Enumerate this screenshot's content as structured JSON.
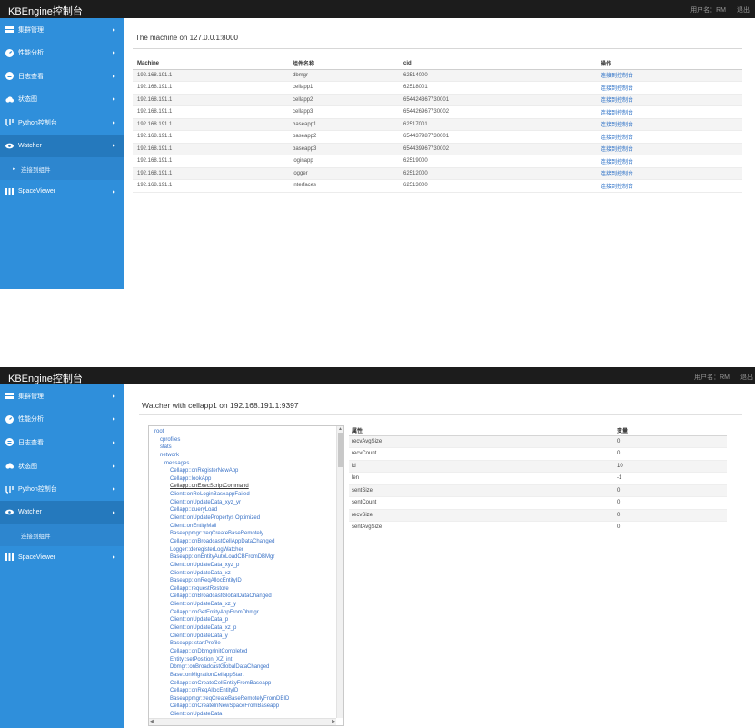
{
  "app": {
    "brand": "KBEngine控制台",
    "user_label": "用户名：RM",
    "logout_label": "退出"
  },
  "sidebar": {
    "items": [
      {
        "label": "集群管理",
        "icon": "server-icon"
      },
      {
        "label": "性能分析",
        "icon": "gauge-icon"
      },
      {
        "label": "日志查看",
        "icon": "log-icon"
      },
      {
        "label": "状态图",
        "icon": "cloud-icon"
      },
      {
        "label": "Python控制台",
        "icon": "python-icon"
      },
      {
        "label": "Watcher",
        "icon": "eye-icon"
      },
      {
        "label": "SpaceViewer",
        "icon": "spaceviewer-icon"
      }
    ],
    "watcher_subitem": "连接到组件"
  },
  "screen1": {
    "title": "The machine on 127.0.0.1:8000",
    "columns": [
      "Machine",
      "组件名称",
      "cid",
      "操作"
    ],
    "rows": [
      {
        "machine": "192.168.191.1",
        "name": "dbmgr",
        "cid": "62514000",
        "action": "连接到控制台"
      },
      {
        "machine": "192.168.191.1",
        "name": "cellapp1",
        "cid": "62518001",
        "action": "连接到控制台"
      },
      {
        "machine": "192.168.191.1",
        "name": "cellapp2",
        "cid": "654424367730001",
        "action": "连接到控制台"
      },
      {
        "machine": "192.168.191.1",
        "name": "cellapp3",
        "cid": "654426967730002",
        "action": "连接到控制台"
      },
      {
        "machine": "192.168.191.1",
        "name": "baseapp1",
        "cid": "62517001",
        "action": "连接到控制台"
      },
      {
        "machine": "192.168.191.1",
        "name": "baseapp2",
        "cid": "654437987730001",
        "action": "连接到控制台"
      },
      {
        "machine": "192.168.191.1",
        "name": "baseapp3",
        "cid": "654439967730002",
        "action": "连接到控制台"
      },
      {
        "machine": "192.168.191.1",
        "name": "loginapp",
        "cid": "62519000",
        "action": "连接到控制台"
      },
      {
        "machine": "192.168.191.1",
        "name": "logger",
        "cid": "62512000",
        "action": "连接到控制台"
      },
      {
        "machine": "192.168.191.1",
        "name": "interfaces",
        "cid": "62513000",
        "action": "连接到控制台"
      }
    ]
  },
  "screen2": {
    "title": "Watcher with cellapp1 on 192.168.191.1:9397",
    "tree": [
      {
        "label": "root",
        "depth": 0
      },
      {
        "label": "cprofiles",
        "depth": 1
      },
      {
        "label": "stats",
        "depth": 1
      },
      {
        "label": "network",
        "depth": 1
      },
      {
        "label": "messages",
        "depth": 2
      },
      {
        "label": "Cellapp::onRegisterNewApp",
        "depth": 3
      },
      {
        "label": "Cellapp::lookApp",
        "depth": 3
      },
      {
        "label": "Cellapp::onExecScriptCommand",
        "depth": 3,
        "selected": true
      },
      {
        "label": "Client::onReLoginBaseappFailed",
        "depth": 3
      },
      {
        "label": "Client::onUpdateData_xyz_yr",
        "depth": 3
      },
      {
        "label": "Cellapp::queryLoad",
        "depth": 3
      },
      {
        "label": "Client::onUpdatePropertys Optimized",
        "depth": 3
      },
      {
        "label": "Client::onEntityMail",
        "depth": 3
      },
      {
        "label": "Baseappmgr::reqCreateBaseRemotely",
        "depth": 3
      },
      {
        "label": "Cellapp::onBroadcastCellAppDataChanged",
        "depth": 3
      },
      {
        "label": "Logger::deregisterLogWatcher",
        "depth": 3
      },
      {
        "label": "Baseapp::onEntityAutoLoadCBFromDBMgr",
        "depth": 3
      },
      {
        "label": "Client::onUpdateData_xyz_p",
        "depth": 3
      },
      {
        "label": "Client::onUpdateData_xz",
        "depth": 3
      },
      {
        "label": "Baseapp::onReqAllocEntityID",
        "depth": 3
      },
      {
        "label": "Cellapp::requestRestore",
        "depth": 3
      },
      {
        "label": "Cellapp::onBroadcastGlobalDataChanged",
        "depth": 3
      },
      {
        "label": "Client::onUpdateData_xz_y",
        "depth": 3
      },
      {
        "label": "Cellapp::onGetEntityAppFromDbmgr",
        "depth": 3
      },
      {
        "label": "Client::onUpdateData_p",
        "depth": 3
      },
      {
        "label": "Client::onUpdateData_xz_p",
        "depth": 3
      },
      {
        "label": "Client::onUpdateData_y",
        "depth": 3
      },
      {
        "label": "Baseapp::startProfile",
        "depth": 3
      },
      {
        "label": "Cellapp::onDbmgrInitCompleted",
        "depth": 3
      },
      {
        "label": "Entity::setPosition_XZ_int",
        "depth": 3
      },
      {
        "label": "Dbmgr::onBroadcastGlobalDataChanged",
        "depth": 3
      },
      {
        "label": "Base::onMigrationCellappStart",
        "depth": 3
      },
      {
        "label": "Cellapp::onCreateCellEntityFromBaseapp",
        "depth": 3
      },
      {
        "label": "Cellapp::onReqAllocEntityID",
        "depth": 3
      },
      {
        "label": "Baseappmgr::reqCreateBaseRemotelyFromDBID",
        "depth": 3
      },
      {
        "label": "Cellapp::onCreateInNewSpaceFromBaseapp",
        "depth": 3
      },
      {
        "label": "Client::onUpdateData",
        "depth": 3
      }
    ],
    "props_columns": [
      "属性",
      "变量"
    ],
    "props": [
      {
        "key": "recvAvgSize",
        "value": "0"
      },
      {
        "key": "recvCount",
        "value": "0"
      },
      {
        "key": "id",
        "value": "10"
      },
      {
        "key": "len",
        "value": "-1"
      },
      {
        "key": "sentSize",
        "value": "0"
      },
      {
        "key": "sentCount",
        "value": "0"
      },
      {
        "key": "recvSize",
        "value": "0"
      },
      {
        "key": "sentAvgSize",
        "value": "0"
      }
    ]
  },
  "colors": {
    "topbar": "#1c1c1c",
    "sidebar": "#2f8fdb",
    "sidebar_active": "#2579bd",
    "link": "#2a6fc6"
  }
}
